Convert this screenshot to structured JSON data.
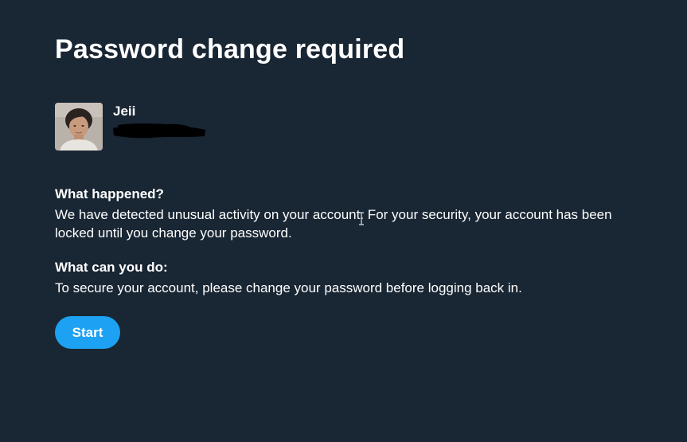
{
  "page": {
    "title": "Password change required"
  },
  "profile": {
    "name": "Jeii",
    "handle_redacted": true
  },
  "sections": [
    {
      "heading": "What happened?",
      "body": "We have detected unusual activity on your account. For your security, your account has been locked until you change your password."
    },
    {
      "heading": "What can you do:",
      "body": "To secure your account, please change your password before logging back in."
    }
  ],
  "actions": {
    "start_label": "Start"
  },
  "colors": {
    "background": "#192633",
    "text": "#ffffff",
    "primary_button": "#1da1f2"
  },
  "icons": {
    "avatar": "profile-photo",
    "cursor": "text-cursor-icon"
  }
}
